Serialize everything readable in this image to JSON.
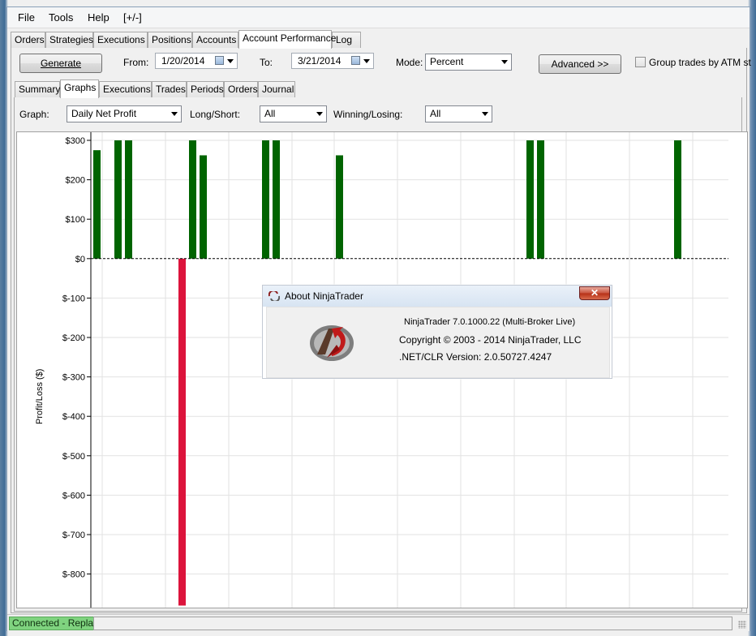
{
  "menu": {
    "file": "File",
    "tools": "Tools",
    "help": "Help",
    "toggle": "[+/-]"
  },
  "main_tabs": [
    "Orders",
    "Strategies",
    "Executions",
    "Positions",
    "Accounts",
    "Account Performance",
    "Log"
  ],
  "toolbar": {
    "generate_label": "Generate",
    "from_label": "From:",
    "from_value": "1/20/2014",
    "to_label": "To:",
    "to_value": "3/21/2014",
    "mode_label": "Mode:",
    "mode_value": "Percent",
    "advanced_label": "Advanced >>",
    "group_trades_label": "Group trades by ATM st"
  },
  "sub_tabs": [
    "Summary",
    "Graphs",
    "Executions",
    "Trades",
    "Periods",
    "Orders",
    "Journal"
  ],
  "filters": {
    "graph_label": "Graph:",
    "graph_value": "Daily Net Profit",
    "longshort_label": "Long/Short:",
    "longshort_value": "All",
    "winlose_label": "Winning/Losing:",
    "winlose_value": "All"
  },
  "chart_data": {
    "type": "bar",
    "ylabel": "Profit/Loss ($)",
    "y_ticks": [
      "$300",
      "$200",
      "$100",
      "$0",
      "$-100",
      "$-200",
      "$-300",
      "$-400",
      "$-500",
      "$-600",
      "$-700",
      "$-800"
    ],
    "ylim": [
      -880,
      300
    ],
    "grid": true,
    "values": [
      275,
      300,
      300,
      -880,
      300,
      262,
      300,
      300,
      262,
      300,
      300,
      300
    ],
    "positive_color": "#006400",
    "negative_color": "#dc143c"
  },
  "about_dialog": {
    "title": "About NinjaTrader",
    "close": "✕",
    "version": "NinjaTrader 7.0.1000.22 (Multi-Broker Live)",
    "copyright": "Copyright © 2003 - 2014 NinjaTrader, LLC",
    "clr": ".NET/CLR Version: 2.0.50727.4247"
  },
  "status": {
    "connection": "Connected - Replay",
    "connection_color": "#7fd37f"
  }
}
